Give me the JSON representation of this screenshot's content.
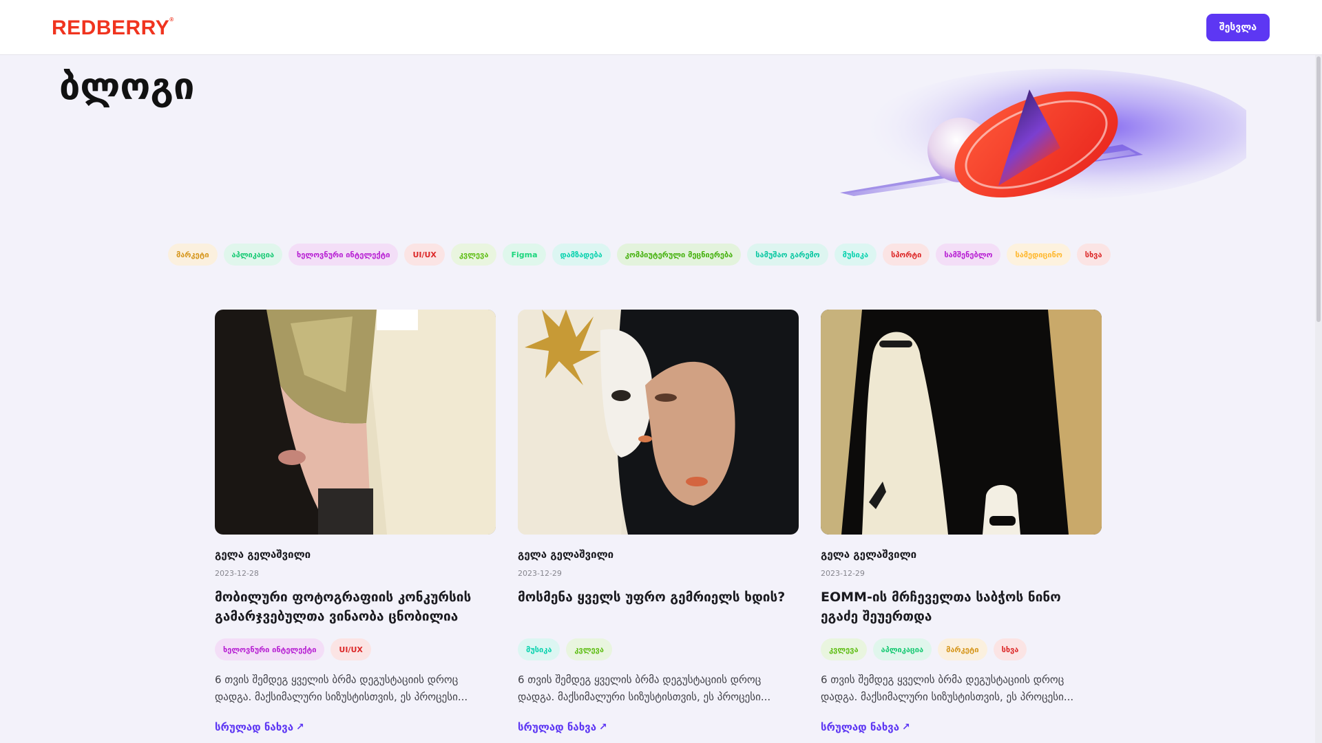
{
  "header": {
    "logo": "REDBERRY",
    "login_label": "შესვლა"
  },
  "page": {
    "title": "ბლოგი"
  },
  "categories": [
    {
      "label": "მარკეტი",
      "text_color": "#d6961c",
      "bg_color": "#fbf0de"
    },
    {
      "label": "აპლიკაცია",
      "text_color": "#15c972",
      "bg_color": "#e0f6ec"
    },
    {
      "label": "ხელოვნური ინტელექტი",
      "text_color": "#b71fd3",
      "bg_color": "#f3def7"
    },
    {
      "label": "UI/UX",
      "text_color": "#dc2828",
      "bg_color": "#fbe4e4"
    },
    {
      "label": "კვლევა",
      "text_color": "#60be16",
      "bg_color": "#e9f5df"
    },
    {
      "label": "Figma",
      "text_color": "#1cd67d",
      "bg_color": "#dff7ec"
    },
    {
      "label": "დამზადება",
      "text_color": "#08d2ae",
      "bg_color": "#dcf6f2"
    },
    {
      "label": "კომპიუტერული მეცნიერება",
      "text_color": "#45b10d",
      "bg_color": "#e3f3dc"
    },
    {
      "label": "სამუშაო გარემო",
      "text_color": "#08c7a1",
      "bg_color": "#ddf5f0"
    },
    {
      "label": "მუსიკა",
      "text_color": "#08d2ae",
      "bg_color": "#dcf6f2"
    },
    {
      "label": "სპორტი",
      "text_color": "#dc2828",
      "bg_color": "#fbe4e4"
    },
    {
      "label": "სამშენებლო",
      "text_color": "#b71fd3",
      "bg_color": "#f3def7"
    },
    {
      "label": "სამედიცინო",
      "text_color": "#ffb82e",
      "bg_color": "#fdf2de"
    },
    {
      "label": "სხვა",
      "text_color": "#dc2828",
      "bg_color": "#fbe4e4"
    }
  ],
  "posts": [
    {
      "author": "გელა გელაშვილი",
      "date": "2023-12-28",
      "title": "მობილური ფოტოგრაფიის კონკურსის გამარჯვებულთა ვინაობა ცნობილია",
      "tags": [
        {
          "label": "ხელოვნური ინტელექტი",
          "text_color": "#b71fd3",
          "bg_color": "#f3def7"
        },
        {
          "label": "UI/UX",
          "text_color": "#dc2828",
          "bg_color": "#fbe4e4"
        }
      ],
      "description_line1": "6 თვის შემდეგ ყველის ბრმა დეგუსტაციის დროც",
      "description_line2": "დადგა. მაქსიმალური სიზუსტისთვის, ეს პროცესი...",
      "link_label": "სრულად ნახვა"
    },
    {
      "author": "გელა გელაშვილი",
      "date": "2023-12-29",
      "title": "მოსმენა ყველს უფრო გემრიელს ხდის?",
      "tags": [
        {
          "label": "მუსიკა",
          "text_color": "#08d2ae",
          "bg_color": "#dcf6f2"
        },
        {
          "label": "კვლევა",
          "text_color": "#60be16",
          "bg_color": "#e9f5df"
        }
      ],
      "description_line1": "6 თვის შემდეგ ყველის ბრმა დეგუსტაციის დროც",
      "description_line2": "დადგა. მაქსიმალური სიზუსტისთვის, ეს პროცესი...",
      "link_label": "სრულად ნახვა"
    },
    {
      "author": "გელა გელაშვილი",
      "date": "2023-12-29",
      "title": "EOMM-ის მრჩეველთა საბჭოს ნინო ეგაძე შეუერთდა",
      "tags": [
        {
          "label": "კვლევა",
          "text_color": "#60be16",
          "bg_color": "#e9f5df"
        },
        {
          "label": "აპლიკაცია",
          "text_color": "#15c972",
          "bg_color": "#e0f6ec"
        },
        {
          "label": "მარკეტი",
          "text_color": "#d6961c",
          "bg_color": "#fbf0de"
        },
        {
          "label": "სხვა",
          "text_color": "#dc2828",
          "bg_color": "#fbe4e4"
        }
      ],
      "description_line1": "6 თვის შემდეგ ყველის ბრმა დეგუსტაციის დროც",
      "description_line2": "დადგა. მაქსიმალური სიზუსტისთვის, ეს პროცესი...",
      "link_label": "სრულად ნახვა"
    }
  ],
  "colors": {
    "accent": "#5d37f3",
    "brand": "#f0341f",
    "background": "#f3f2fa"
  }
}
